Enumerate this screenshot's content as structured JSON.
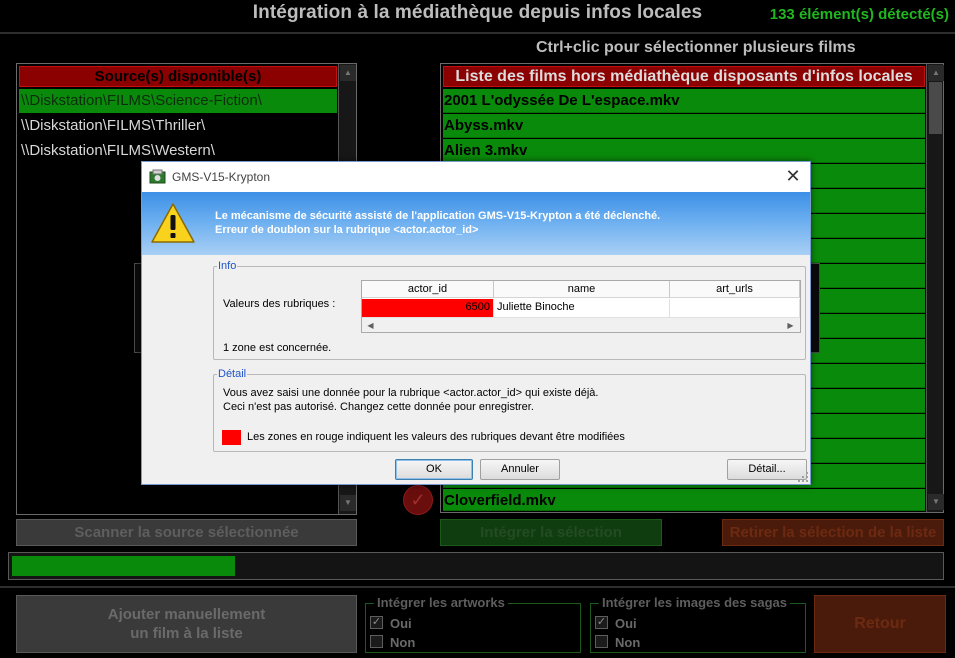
{
  "header": {
    "title": "Intégration à la médiathèque depuis infos locales",
    "count": "133 élément(s) détecté(s)",
    "hint": "Ctrl+clic pour sélectionner plusieurs films"
  },
  "sources": {
    "header": "Source(s) disponible(s)",
    "items": [
      {
        "label": "\\\\Diskstation\\FILMS\\Science-Fiction\\",
        "selected": true
      },
      {
        "label": "\\\\Diskstation\\FILMS\\Thriller\\",
        "selected": false
      },
      {
        "label": "\\\\Diskstation\\FILMS\\Western\\",
        "selected": false
      }
    ]
  },
  "films": {
    "header": "Liste des films hors médiathèque disposants d'infos locales",
    "items": [
      "2001 L'odyssée De L'espace.mkv",
      "Abyss.mkv",
      "Alien 3.mkv"
    ],
    "last_item": "Cloverfield.mkv"
  },
  "buttons": {
    "scan": "Scanner la source sélectionnée",
    "integrate": "Intégrer la sélection",
    "remove": "Retirer la sélection de la liste",
    "add_line1": "Ajouter manuellement",
    "add_line2": "un film à la liste",
    "retour": "Retour"
  },
  "progress": {
    "value": 0.24
  },
  "artworks_group": {
    "legend": "Intégrer les artworks",
    "options": [
      {
        "label": "Oui",
        "checked": true
      },
      {
        "label": "Non",
        "checked": false
      }
    ]
  },
  "sagas_group": {
    "legend": "Intégrer les images des sagas",
    "options": [
      {
        "label": "Oui",
        "checked": true
      },
      {
        "label": "Non",
        "checked": false
      }
    ]
  },
  "dialog": {
    "title": "GMS-V15-Krypton",
    "message_line1": "Le mécanisme de sécurité assisté de l'application GMS-V15-Krypton a été déclenché.",
    "message_line2": "Erreur de doublon sur la rubrique <actor.actor_id>",
    "info": {
      "legend": "Info",
      "values_label": "Valeurs des rubriques :",
      "columns": [
        "actor_id",
        "name",
        "art_urls"
      ],
      "row": {
        "actor_id": "6500",
        "name": "Juliette Binoche",
        "art_urls": ""
      },
      "zone_text": "1 zone est concernée."
    },
    "detail": {
      "legend": "Détail",
      "line1": "Vous avez saisi une donnée pour la rubrique <actor.actor_id> qui existe déjà.",
      "line2": "Ceci n'est pas autorisé. Changez cette donnée pour enregistrer.",
      "legend_note": "Les zones en rouge indiquent les valeurs des rubriques devant être modifiées"
    },
    "buttons": {
      "ok": "OK",
      "cancel": "Annuler",
      "detail": "Détail..."
    }
  },
  "colors": {
    "accent_green": "#0a8a0a",
    "header_red": "#8b0000",
    "error_red": "#ff0000",
    "dialog_banner": "#3c8fe6"
  }
}
